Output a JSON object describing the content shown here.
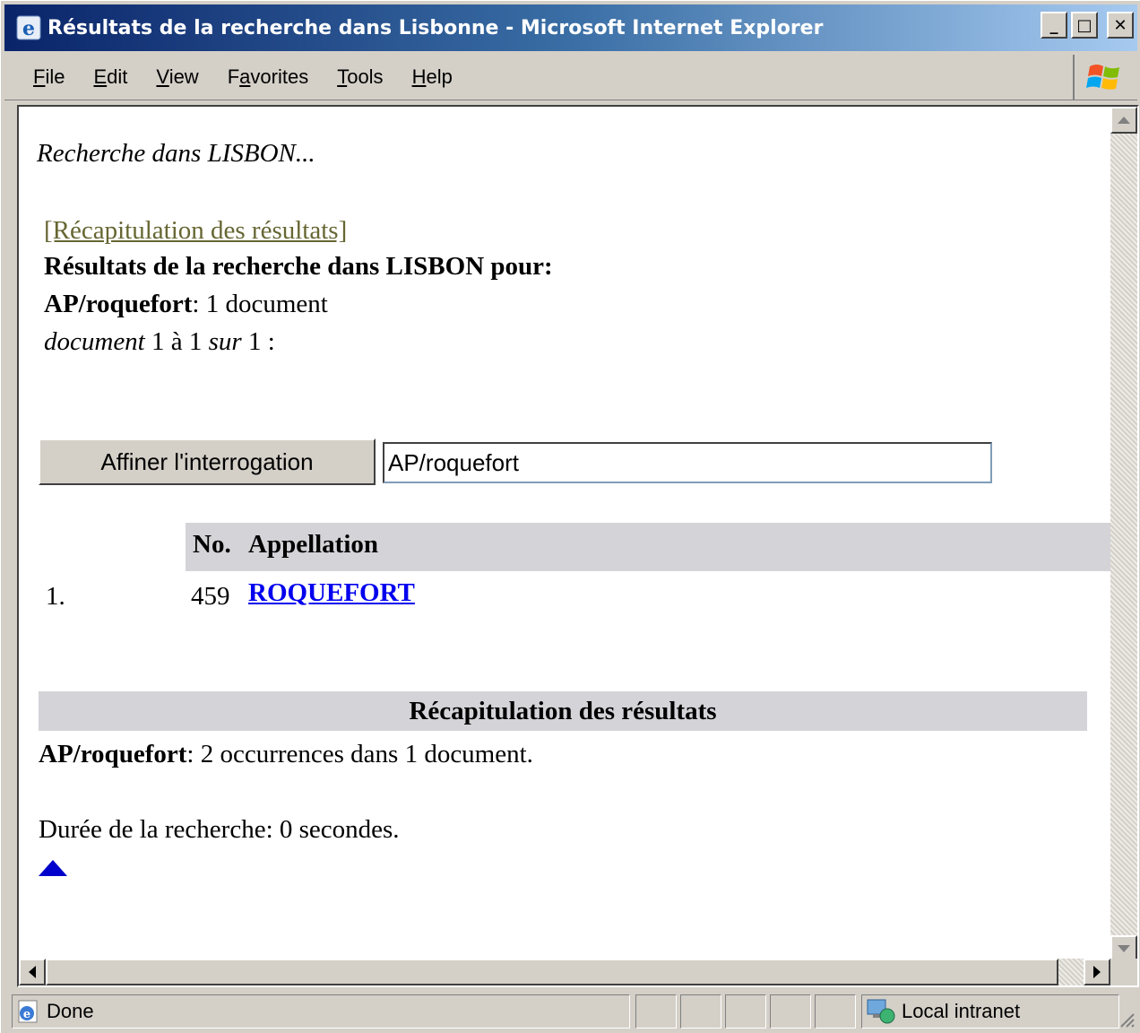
{
  "window": {
    "title": "Résultats de la recherche dans Lisbonne - Microsoft Internet Explorer",
    "minimize_label": "_",
    "maximize_label": "□",
    "close_label": "✕"
  },
  "menu": {
    "items": [
      {
        "accel": "F",
        "rest": "ile"
      },
      {
        "accel": "E",
        "rest": "dit"
      },
      {
        "accel": "V",
        "rest": "iew"
      },
      {
        "pre": "F",
        "accel": "a",
        "rest": "vorites"
      },
      {
        "accel": "T",
        "rest": "ools"
      },
      {
        "accel": "H",
        "rest": "elp"
      }
    ]
  },
  "page": {
    "searching_text": "Recherche dans LISBON...",
    "summary_link": "[Récapitulation des résultats]",
    "results_heading": "Résultats de la recherche dans LISBON pour:",
    "query_term": "AP/roquefort",
    "query_count": ": 1 document",
    "range_doc": "document",
    "range_mid": " 1 à 1 ",
    "range_sur": "sur",
    "range_end": " 1 :",
    "refine_button": "Affiner l'interrogation",
    "query_input_value": "AP/roquefort",
    "table": {
      "headers": [
        "No.",
        "Appellation"
      ],
      "rows": [
        {
          "index": "1.",
          "no": "459",
          "appellation": "ROQUEFORT"
        }
      ]
    },
    "recap_heading": "Récapitulation des résultats",
    "recap_term": "AP/roquefort",
    "recap_text": ": 2 occurrences dans 1 document.",
    "duration": "Durée de la recherche: 0 secondes."
  },
  "status": {
    "text": "Done",
    "zone": "Local intranet"
  },
  "colors": {
    "link": "#0000ee",
    "visited_link": "#666633",
    "table_header": "#d4d3d8"
  }
}
